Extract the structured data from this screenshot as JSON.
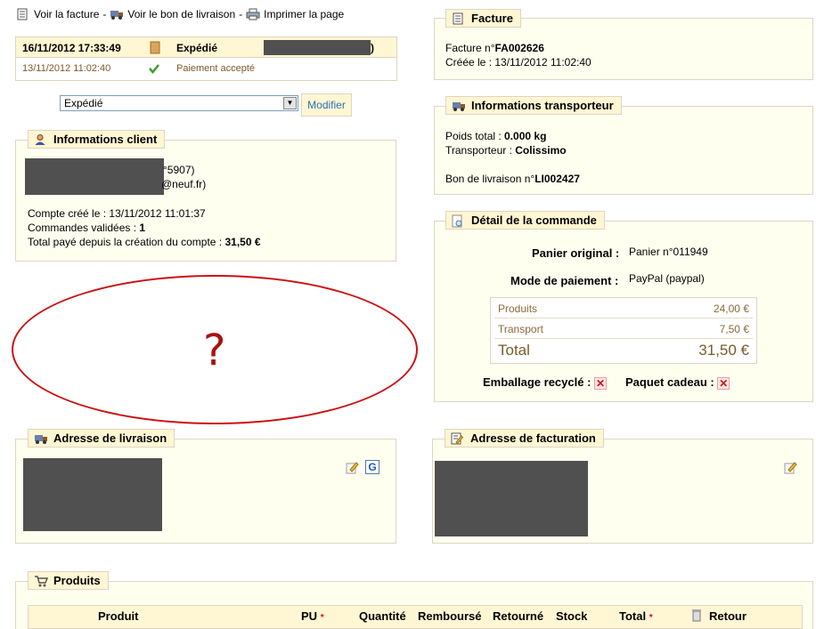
{
  "toplinks": {
    "invoice": "Voir la facture",
    "sep1": "-",
    "delivery": "Voir le bon de livraison",
    "sep2": "-",
    "print": "Imprimer la page"
  },
  "history": {
    "row1": {
      "date": "16/11/2012 17:33:49",
      "status": "Expédié",
      "suffix": ")"
    },
    "row2": {
      "date": "13/11/2012 11:02:40",
      "status": "Paiement accepté"
    }
  },
  "state_select": {
    "value": "Expédié"
  },
  "modify_button": "Modifier",
  "client": {
    "legend": "Informations client",
    "phone_fragment": "°5907)",
    "email_fragment": "@neuf.fr)",
    "account_created_label": "Compte créé le :",
    "account_created_value": "13/11/2012 11:01:37",
    "orders_label": "Commandes validées :",
    "orders_value": "1",
    "total_label": "Total payé depuis la création du compte :",
    "total_value": "31,50 €"
  },
  "annotation": {
    "mark": "?",
    "color": "#cc1111"
  },
  "invoice": {
    "legend": "Facture",
    "number_label": "Facture n°",
    "number_value": "FA002626",
    "created_label": "Créée le :",
    "created_value": "13/11/2012 11:02:40"
  },
  "carrier": {
    "legend": "Informations transporteur",
    "weight_label": "Poids total :",
    "weight_value": "0.000 kg",
    "carrier_label": "Transporteur :",
    "carrier_value": "Colissimo",
    "delivery_label": "Bon de livraison n°",
    "delivery_value": "LI002427"
  },
  "order_detail": {
    "legend": "Détail de la commande",
    "cart_label": "Panier original :",
    "cart_value": "Panier n°011949",
    "payment_label": "Mode de paiement :",
    "payment_value": "PayPal (paypal)",
    "rows": [
      {
        "label": "Produits",
        "value": "24,00 €"
      },
      {
        "label": "Transport",
        "value": "7,50 €"
      }
    ],
    "total": {
      "label": "Total",
      "value": "31,50 €"
    },
    "recycled_label": "Emballage recyclé :",
    "gift_label": "Paquet cadeau :"
  },
  "delivery_address": {
    "legend": "Adresse de livraison"
  },
  "billing_address": {
    "legend": "Adresse de facturation"
  },
  "products": {
    "legend": "Produits",
    "columns": {
      "product": "Produit",
      "unit_price": "PU",
      "quantity": "Quantité",
      "refunded": "Remboursé",
      "returned": "Retourné",
      "stock": "Stock",
      "total": "Total",
      "return": "Retour"
    },
    "required_mark": "*"
  },
  "colors": {
    "legend_bg": "#fff6d3",
    "panel_bg": "#fffff0",
    "border": "#dfd5c3",
    "link_blue": "#2b6fb6",
    "redaction": "#505050"
  }
}
